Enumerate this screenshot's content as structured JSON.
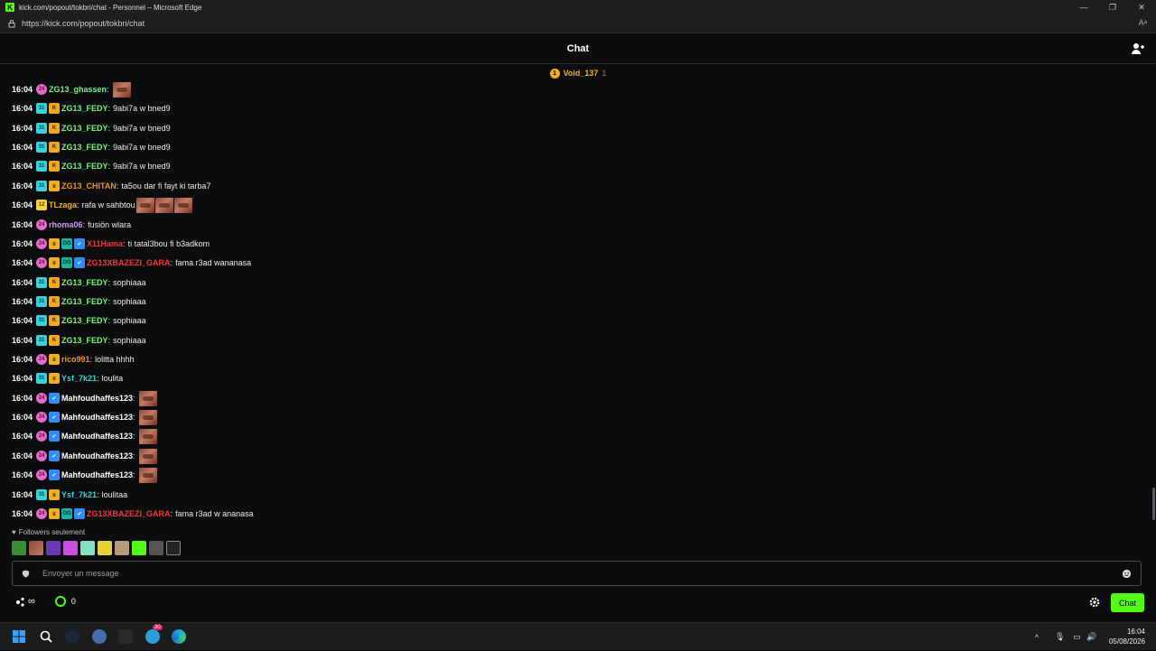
{
  "window": {
    "title": "kick.com/popout/tokbri/chat - Personnel – Microsoft Edge",
    "url": "https://kick.com/popout/tokbri/chat",
    "reader_mode": "Aᵃ"
  },
  "chat": {
    "title": "Chat",
    "pinned_user": "Void_137",
    "pinned_count": "1"
  },
  "messages": [
    {
      "time": "16:04",
      "badges": [
        "sub-pink"
      ],
      "user": "ZG13_ghassen",
      "color": "#7cf07c",
      "text": "",
      "emotes": 1
    },
    {
      "time": "16:04",
      "badges": [
        "sub-cyan",
        "kick"
      ],
      "user": "ZG13_FEDY",
      "color": "#7cf07c",
      "text": "9abi7a w bned9",
      "emotes": 0
    },
    {
      "time": "16:04",
      "badges": [
        "sub-cyan",
        "kick"
      ],
      "user": "ZG13_FEDY",
      "color": "#7cf07c",
      "text": "9abi7a w bned9",
      "emotes": 0
    },
    {
      "time": "16:04",
      "badges": [
        "sub-cyan",
        "kick"
      ],
      "user": "ZG13_FEDY",
      "color": "#7cf07c",
      "text": "9abi7a w bned9",
      "emotes": 0
    },
    {
      "time": "16:04",
      "badges": [
        "sub-cyan",
        "kick"
      ],
      "user": "ZG13_FEDY",
      "color": "#7cf07c",
      "text": "9abi7a w bned9",
      "emotes": 0
    },
    {
      "time": "16:04",
      "badges": [
        "sub-cyan",
        "crown"
      ],
      "user": "ZG13_CHITAN",
      "color": "#f2932a",
      "text": "ta5ou dar fi fayt ki tarba7",
      "emotes": 0
    },
    {
      "time": "16:04",
      "badges": [
        "sub-yellow"
      ],
      "user": "TLzaga",
      "color": "#f2b01e",
      "text": "rafa w sahbtou",
      "emotes": 3
    },
    {
      "time": "16:04",
      "badges": [
        "sub-pink"
      ],
      "user": "rhoma06",
      "color": "#c99af2",
      "text": "fusiön wlara",
      "emotes": 0
    },
    {
      "time": "16:04",
      "badges": [
        "sub-pink",
        "crown",
        "og",
        "verified"
      ],
      "user": "X11Hama",
      "color": "#f23a3a",
      "text": "ti tatal3bou fi b3adkom",
      "emotes": 0
    },
    {
      "time": "16:04",
      "badges": [
        "sub-pink",
        "crown",
        "og",
        "verified"
      ],
      "user": "ZG13XBAZEZI_GARA",
      "color": "#f23a3a",
      "text": "fama r3ad wananasa",
      "emotes": 0
    },
    {
      "time": "16:04",
      "badges": [
        "sub-cyan",
        "kick"
      ],
      "user": "ZG13_FEDY",
      "color": "#7cf07c",
      "text": "sophiaaa",
      "emotes": 0
    },
    {
      "time": "16:04",
      "badges": [
        "sub-cyan",
        "kick"
      ],
      "user": "ZG13_FEDY",
      "color": "#7cf07c",
      "text": "sophiaaa",
      "emotes": 0
    },
    {
      "time": "16:04",
      "badges": [
        "sub-cyan",
        "kick"
      ],
      "user": "ZG13_FEDY",
      "color": "#7cf07c",
      "text": "sophiaaa",
      "emotes": 0
    },
    {
      "time": "16:04",
      "badges": [
        "sub-cyan",
        "kick"
      ],
      "user": "ZG13_FEDY",
      "color": "#7cf07c",
      "text": "sophiaaa",
      "emotes": 0
    },
    {
      "time": "16:04",
      "badges": [
        "sub-pink",
        "crown"
      ],
      "user": "rico991",
      "color": "#f2932a",
      "text": "lolitta hhhh",
      "emotes": 0
    },
    {
      "time": "16:04",
      "badges": [
        "sub-cyan",
        "crown"
      ],
      "user": "Ysf_7k21",
      "color": "#3bd1d8",
      "text": "loulita",
      "emotes": 0
    },
    {
      "time": "16:04",
      "badges": [
        "sub-pink",
        "verified"
      ],
      "user": "Mahfoudhaffes123",
      "color": "#ffffff",
      "text": "",
      "emotes": 1
    },
    {
      "time": "16:04",
      "badges": [
        "sub-pink",
        "verified"
      ],
      "user": "Mahfoudhaffes123",
      "color": "#ffffff",
      "text": "",
      "emotes": 1
    },
    {
      "time": "16:04",
      "badges": [
        "sub-pink",
        "verified"
      ],
      "user": "Mahfoudhaffes123",
      "color": "#ffffff",
      "text": "",
      "emotes": 1
    },
    {
      "time": "16:04",
      "badges": [
        "sub-pink",
        "verified"
      ],
      "user": "Mahfoudhaffes123",
      "color": "#ffffff",
      "text": "",
      "emotes": 1
    },
    {
      "time": "16:04",
      "badges": [
        "sub-pink",
        "verified"
      ],
      "user": "Mahfoudhaffes123",
      "color": "#ffffff",
      "text": "",
      "emotes": 1
    },
    {
      "time": "16:04",
      "badges": [
        "sub-cyan",
        "crown"
      ],
      "user": "Ysf_7k21",
      "color": "#3bd1d8",
      "text": "loulitaa",
      "emotes": 0
    },
    {
      "time": "16:04",
      "badges": [
        "sub-pink",
        "crown",
        "og",
        "verified"
      ],
      "user": "ZG13XBAZEZI_GARA",
      "color": "#f23a3a",
      "text": "fama r3ad w ananasa",
      "emotes": 0
    }
  ],
  "footer": {
    "followers_only": "Followers seulement",
    "message_placeholder": "Envoyer un message",
    "infinity": "∞",
    "points": "0",
    "chat_button": "Chat"
  },
  "taskbar": {
    "time": "16:04",
    "date": "05/08/2026",
    "telegram_badge": "30"
  },
  "colors": {
    "kick_green": "#53fc18",
    "background": "#0b0c0d"
  }
}
